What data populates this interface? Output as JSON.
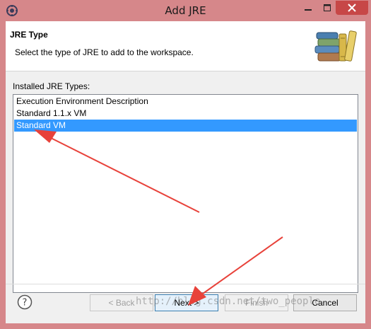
{
  "window": {
    "title": "Add JRE",
    "app_icon": "eclipse-icon",
    "controls": {
      "minimize_icon": "minimize-icon",
      "maximize_icon": "maximize-icon",
      "close_icon": "close-icon"
    },
    "close_color": "#c74747",
    "frame_color": "#d6878a"
  },
  "header": {
    "title": "JRE Type",
    "description": "Select the type of JRE to add to the workspace.",
    "icon": "library-books-icon"
  },
  "list": {
    "label": "Installed JRE Types:",
    "items": [
      {
        "label": "Execution Environment Description",
        "selected": false
      },
      {
        "label": "Standard 1.1.x VM",
        "selected": false
      },
      {
        "label": "Standard VM",
        "selected": true
      }
    ],
    "selection_color": "#3399ff"
  },
  "footer": {
    "help_icon": "help-icon",
    "buttons": {
      "back": "< Back",
      "next": "Next >",
      "finish": "Finish",
      "cancel": "Cancel"
    }
  },
  "watermark": "http://blog.csdn.net/two_people",
  "annotation_color": "#e8423a"
}
